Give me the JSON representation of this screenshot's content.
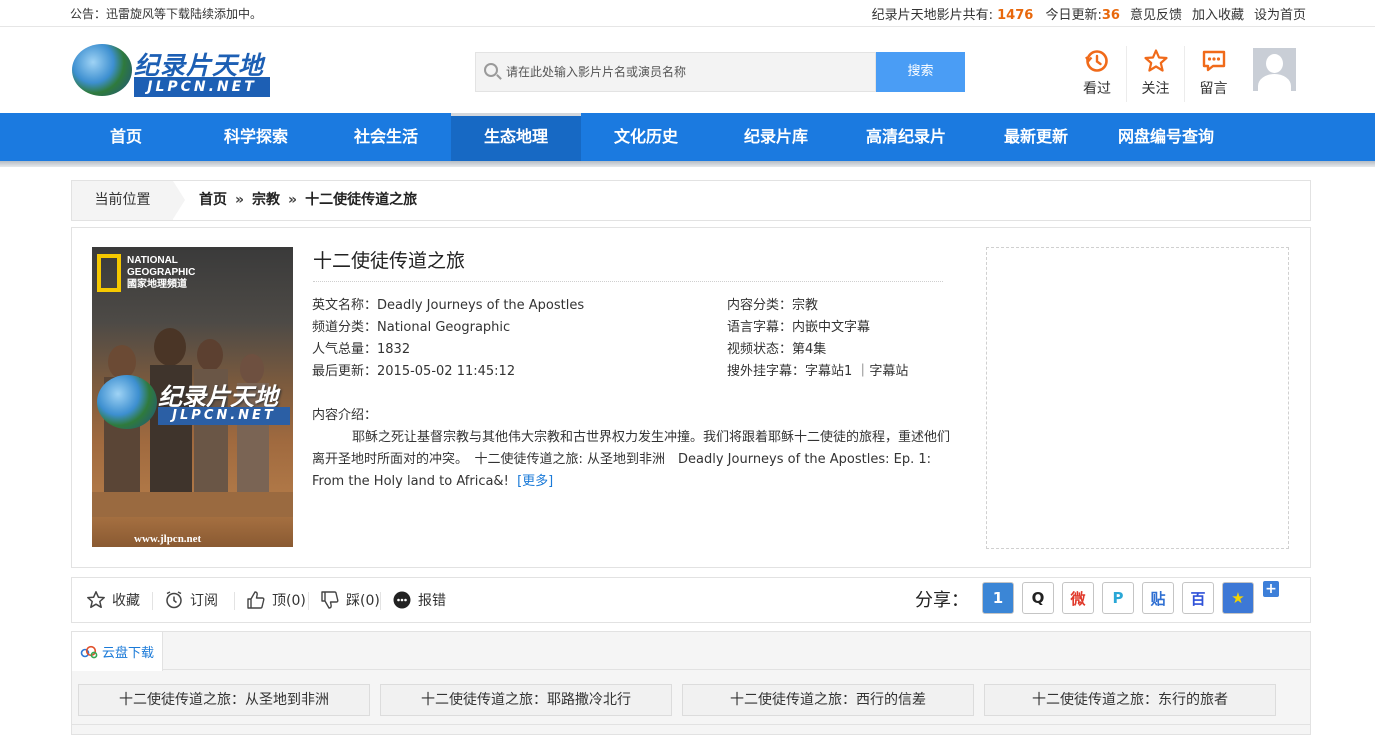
{
  "topbar": {
    "notice": "公告：迅雷旋风等下载陆续添加中。",
    "stats_label": "纪录片天地影片共有:",
    "total_count": "1476",
    "today_label": "今日更新:",
    "today_count": "36",
    "links": [
      "意见反馈",
      "加入收藏",
      "设为首页"
    ]
  },
  "logo": {
    "zh": "纪录片天地",
    "en": "JLPCN.NET"
  },
  "search": {
    "placeholder": "请在此处输入影片片名或演员名称",
    "button": "搜索"
  },
  "header_icons": [
    {
      "icon": "history-icon",
      "label": "看过"
    },
    {
      "icon": "star-icon",
      "label": "关注"
    },
    {
      "icon": "message-icon",
      "label": "留言"
    }
  ],
  "nav": {
    "items": [
      "首页",
      "科学探索",
      "社会生活",
      "生态地理",
      "文化历史",
      "纪录片库",
      "高清纪录片",
      "最新更新",
      "网盘编号查询"
    ],
    "active_index": 3
  },
  "breadcrumb": {
    "label": "当前位置",
    "path": [
      "首页",
      "宗教",
      "十二使徒传道之旅"
    ],
    "separator": "»"
  },
  "detail": {
    "poster": {
      "brand_line1": "NATIONAL",
      "brand_line2": "GEOGRAPHIC",
      "brand_line3": "國家地理頻道",
      "watermark_zh": "纪录片天地",
      "watermark_en": "JLPCN.NET",
      "url": "www.jlpcn.net"
    },
    "title": "十二使徒传道之旅",
    "left_fields": [
      {
        "label": "英文名称：",
        "value": "Deadly Journeys of the Apostles"
      },
      {
        "label": "频道分类：",
        "value": "National Geographic"
      },
      {
        "label": "人气总量：",
        "value": "1832"
      },
      {
        "label": "最后更新：",
        "value": "2015-05-02 11:45:12"
      }
    ],
    "right_fields": [
      {
        "label": "内容分类：",
        "value": "宗教"
      },
      {
        "label": "语言字幕：",
        "value": "内嵌中文字幕"
      },
      {
        "label": "视频状态：",
        "value": "第4集"
      },
      {
        "label": "搜外挂字幕：",
        "value": "字幕站1 ｜字幕站"
      }
    ],
    "desc_label": "内容介绍：",
    "description": "耶稣之死让基督宗教与其他伟大宗教和古世界权力发生冲撞。我们将跟着耶稣十二使徒的旅程，重述他们离开圣地时所面对的冲突。　十二使徒传道之旅: 从圣地到非洲　Deadly Journeys of the Apostles: Ep. 1: From the Holy land to Africa&!",
    "more": "[更多]"
  },
  "actions": {
    "favorite": "收藏",
    "subscribe": "订阅",
    "up": "顶(0)",
    "down": "踩(0)",
    "report": "报错",
    "share_label": "分享："
  },
  "share_buttons": [
    {
      "icon": "share-1-icon",
      "glyph": "1",
      "color": "#3b86d6"
    },
    {
      "icon": "qq-icon",
      "glyph": "Q",
      "color": "#2a2a2a"
    },
    {
      "icon": "weibo-icon",
      "glyph": "微",
      "color": "#e0392b"
    },
    {
      "icon": "tencent-weibo-icon",
      "glyph": "P",
      "color": "#2aa7d6"
    },
    {
      "icon": "tieba-icon",
      "glyph": "贴",
      "color": "#2f6fd2"
    },
    {
      "icon": "baidu-icon",
      "glyph": "百",
      "color": "#2f52d8"
    },
    {
      "icon": "qzone-icon",
      "glyph": "★",
      "color": "#f4b400"
    }
  ],
  "download": {
    "tab": "云盘下载",
    "episodes": [
      "十二使徒传道之旅：从圣地到非洲",
      "十二使徒传道之旅：耶路撒冷北行",
      "十二使徒传道之旅：西行的信差",
      "十二使徒传道之旅：东行的旅者"
    ]
  },
  "colors": {
    "nav_blue": "#1b7ae0",
    "accent_orange": "#e8680c",
    "link_blue": "#1a7ad8",
    "search_button": "#4a9df5"
  }
}
